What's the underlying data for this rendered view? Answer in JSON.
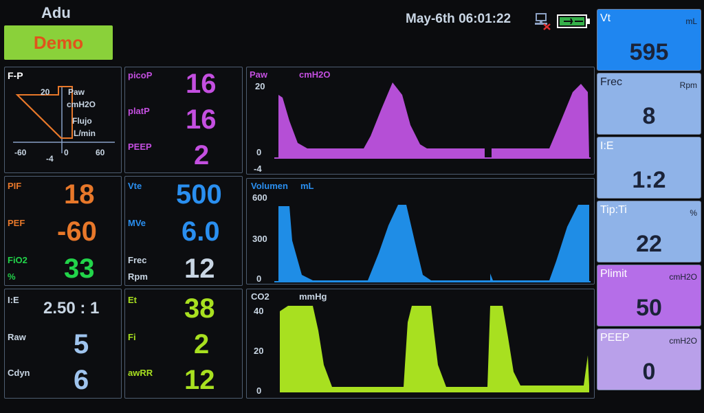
{
  "header": {
    "mode": "Adu",
    "demo_label": "Demo",
    "datetime": "May-6th 06:01:22"
  },
  "fp_loop": {
    "title": "F-P",
    "y_top": "20",
    "y_bottom": "-4",
    "x_left": "-60",
    "x_zero": "0",
    "x_right": "60",
    "label_paw": "Paw",
    "label_paw_unit": "cmH2O",
    "label_flow": "Flujo",
    "label_flow_unit": "L/min"
  },
  "pressure_params": [
    {
      "label": "picoP",
      "value": "16"
    },
    {
      "label": "platP",
      "value": "16"
    },
    {
      "label": "PEEP",
      "value": "2"
    }
  ],
  "flow_params": [
    {
      "label": "PIF",
      "value": "18"
    },
    {
      "label": "PEF",
      "value": "-60"
    },
    {
      "label": "FiO2",
      "label2": "%",
      "value": "33"
    }
  ],
  "volume_params": [
    {
      "label": "Vte",
      "value": "500"
    },
    {
      "label": "MVe",
      "value": "6.0"
    },
    {
      "label": "Frec",
      "label2": "Rpm",
      "value": "12"
    }
  ],
  "mech_params": [
    {
      "label": "I:E",
      "value": "2.50 : 1"
    },
    {
      "label": "Raw",
      "value": "5"
    },
    {
      "label": "Cdyn",
      "value": "6"
    }
  ],
  "co2_params": [
    {
      "label": "Et",
      "value": "38"
    },
    {
      "label": "Fi",
      "value": "2"
    },
    {
      "label": "awRR",
      "value": "12"
    }
  ],
  "waves": {
    "paw": {
      "title": "Paw",
      "unit": "cmH2O",
      "ticks": [
        "20",
        "0",
        "-4"
      ],
      "color": "#b54fd6"
    },
    "volume": {
      "title": "Volumen",
      "unit": "mL",
      "ticks": [
        "600",
        "300",
        "0"
      ],
      "color": "#1f8de6"
    },
    "co2": {
      "title": "CO2",
      "unit": "mmHg",
      "ticks": [
        "40",
        "20",
        "0"
      ],
      "color": "#a8e020"
    }
  },
  "settings": [
    {
      "name": "Vt",
      "unit": "mL",
      "value": "595",
      "color": "#1f86f0"
    },
    {
      "name": "Frec",
      "unit": "Rpm",
      "value": "8",
      "color": "#8fb3e8"
    },
    {
      "name": "I:E",
      "unit": "",
      "value": "1:2",
      "color": "#8fb3e8"
    },
    {
      "name": "Tip:Ti",
      "unit": "%",
      "value": "22",
      "color": "#8fb3e8"
    },
    {
      "name": "Plimit",
      "unit": "cmH2O",
      "value": "50",
      "color": "#b56ee8"
    },
    {
      "name": "PEEP",
      "unit": "cmH2O",
      "value": "0",
      "color": "#b9a0ea"
    }
  ],
  "icons": {
    "network": "network-disconnected-icon",
    "battery": "battery-icon"
  }
}
